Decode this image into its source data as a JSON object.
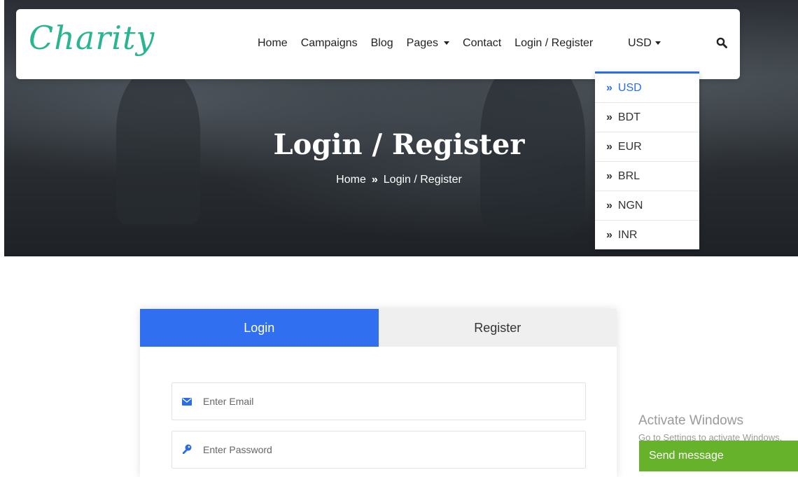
{
  "brand": {
    "logo_text": "Charity",
    "accent_color": "#28b58f"
  },
  "nav": {
    "items": [
      {
        "label": "Home"
      },
      {
        "label": "Campaigns"
      },
      {
        "label": "Blog"
      },
      {
        "label": "Pages"
      },
      {
        "label": "Contact"
      },
      {
        "label": "Login / Register"
      }
    ],
    "currency_selected": "USD",
    "search_icon": "search-icon"
  },
  "currency_dropdown": {
    "options": [
      "USD",
      "BDT",
      "EUR",
      "BRL",
      "NGN",
      "INR"
    ],
    "active": "USD",
    "active_color": "#2a6de8"
  },
  "hero": {
    "title": "Login / Register",
    "breadcrumb": {
      "home": "Home",
      "separator": "»",
      "current": "Login / Register"
    }
  },
  "auth": {
    "tabs": [
      {
        "label": "Login"
      },
      {
        "label": "Register"
      }
    ],
    "active_tab": "Login",
    "active_color": "#2f6ff0",
    "email": {
      "placeholder": "Enter Email",
      "value": "",
      "icon": "envelope-icon"
    },
    "password": {
      "placeholder": "Enter Password",
      "value": "",
      "icon": "key-icon"
    }
  },
  "overlay": {
    "activate_title": "Activate Windows",
    "activate_sub": "Go to Settings to activate Windows.",
    "send_message": "Send message",
    "send_color": "#66b22a"
  }
}
